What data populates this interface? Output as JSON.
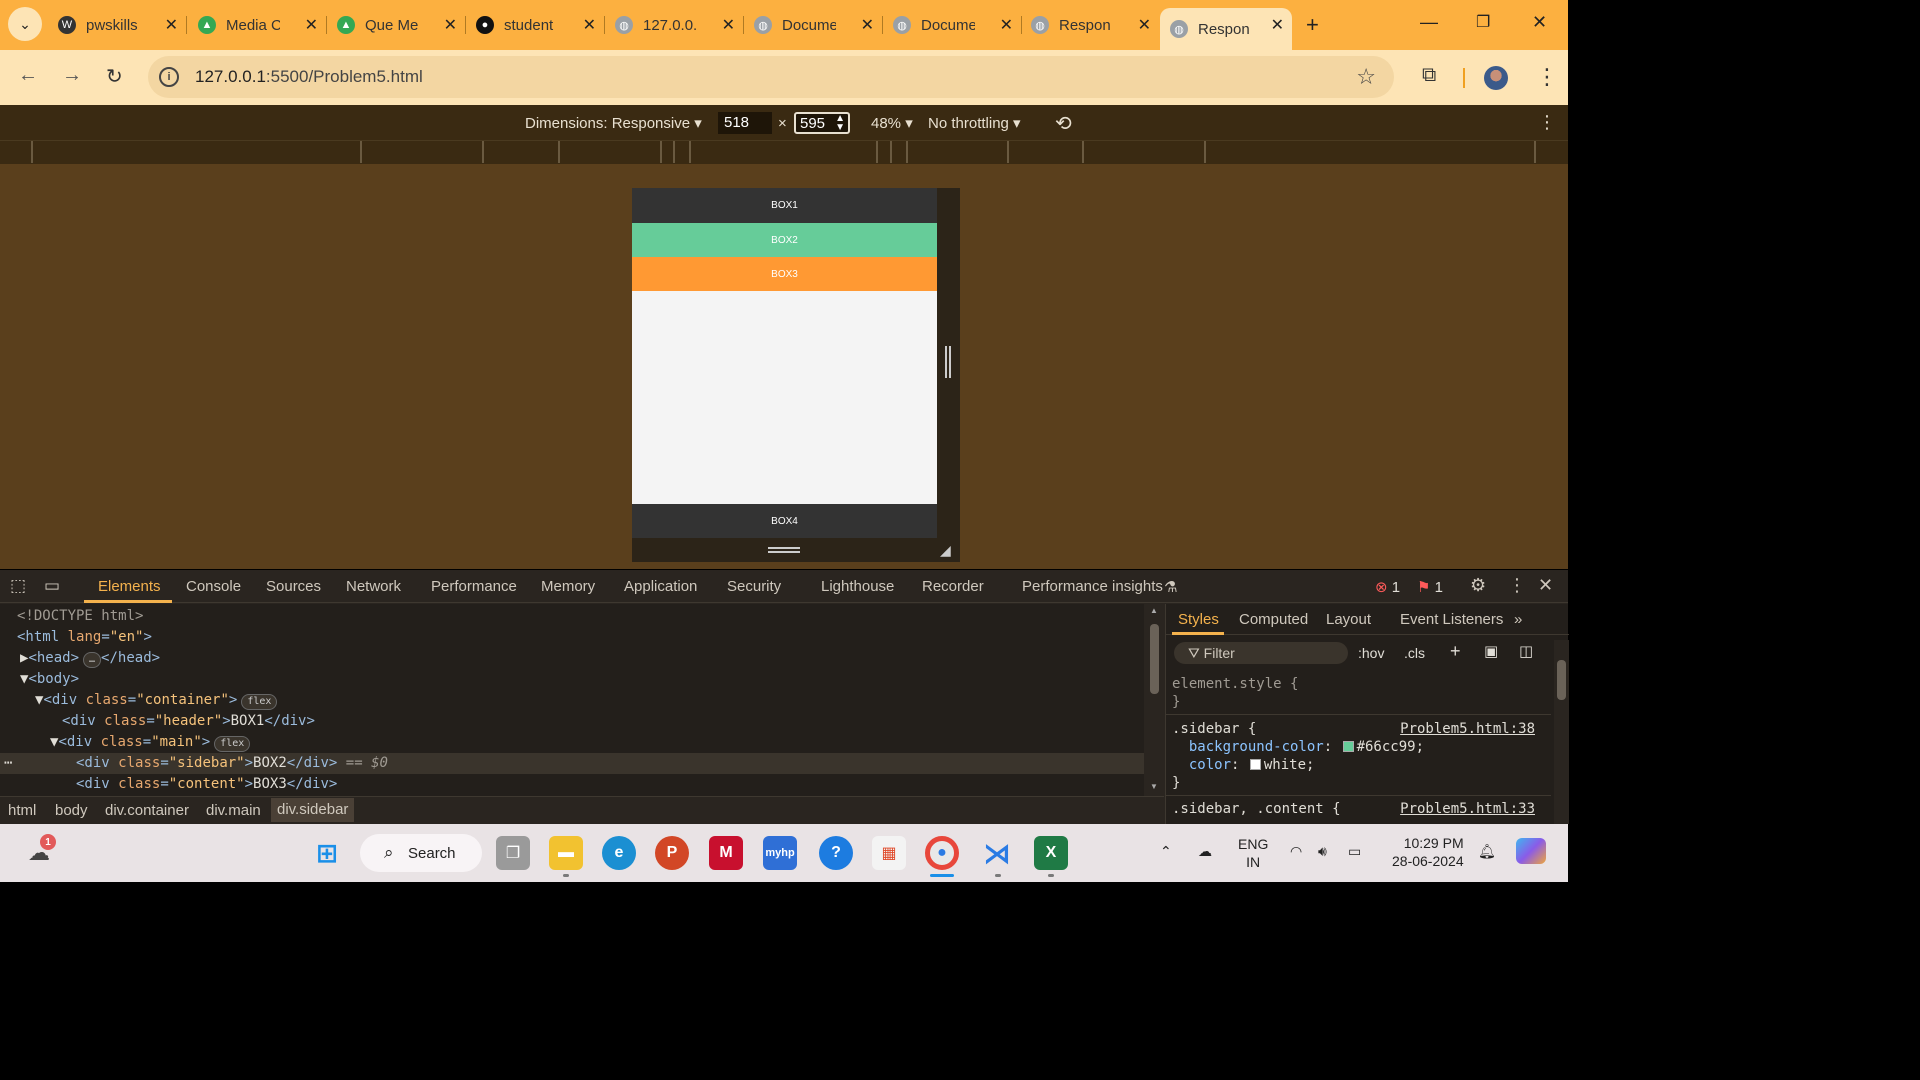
{
  "browser": {
    "tabs": [
      {
        "title": "pwskills",
        "icon": "wordpress-icon",
        "active": false
      },
      {
        "title": "Media C",
        "icon": "google-drive-icon",
        "active": false
      },
      {
        "title": "Que Me",
        "icon": "google-drive-icon",
        "active": false
      },
      {
        "title": "student",
        "icon": "github-icon",
        "active": false
      },
      {
        "title": "127.0.0.",
        "icon": "globe-icon",
        "active": false
      },
      {
        "title": "Docume",
        "icon": "globe-icon",
        "active": false
      },
      {
        "title": "Docume",
        "icon": "globe-icon",
        "active": false
      },
      {
        "title": "Respon",
        "icon": "globe-icon",
        "active": false
      },
      {
        "title": "Respon",
        "icon": "globe-icon",
        "active": true
      }
    ],
    "url_host": "127.0.0.1",
    "url_path": ":5500/Problem5.html"
  },
  "device_toolbar": {
    "dimensions_label": "Dimensions: Responsive",
    "width": "518",
    "height": "595",
    "times": "×",
    "zoom": "48%",
    "throttling": "No throttling"
  },
  "preview": {
    "boxes": [
      {
        "label": "BOX1",
        "color": "#333333"
      },
      {
        "label": "BOX2",
        "color": "#66cc99"
      },
      {
        "label": "BOX3",
        "color": "#ff9933"
      },
      {
        "label": "BOX4",
        "color": "#333333"
      }
    ]
  },
  "devtools": {
    "tabs": [
      "Elements",
      "Console",
      "Sources",
      "Network",
      "Performance",
      "Memory",
      "Application",
      "Security",
      "Lighthouse",
      "Recorder",
      "Performance insights"
    ],
    "error_count": "1",
    "issue_count": "1",
    "dom_lines": {
      "doctype": "<!DOCTYPE html>",
      "html_open": "<html",
      "html_attr": "lang",
      "html_val": "\"en\"",
      "head_open": "<head>",
      "head_close": "</head>",
      "body_open": "<body>",
      "container_open": "<div",
      "container_attr": "class",
      "container_val": "\"container\"",
      "flex_badge": "flex",
      "header_val": "\"header\"",
      "header_text": "BOX1",
      "main_val": "\"main\"",
      "sidebar_val": "\"sidebar\"",
      "sidebar_text": "BOX2",
      "sidebar_marker": "== $0",
      "content_val": "\"content\"",
      "content_text": "BOX3",
      "div_close": "</div>"
    },
    "breadcrumbs": [
      "html",
      "body",
      "div.container",
      "div.main",
      "div.sidebar"
    ],
    "styles_tabs": [
      "Styles",
      "Computed",
      "Layout",
      "Event Listeners"
    ],
    "filter_placeholder": "Filter",
    "hov": ":hov",
    "cls": ".cls",
    "element_style": "element.style {",
    "close_brace": "}",
    "sidebar_rule": {
      "selector": ".sidebar {",
      "source": "Problem5.html:38",
      "bg_prop": "background-color",
      "bg_value": "#66cc99;",
      "bg_swatch": "#66cc99",
      "color_prop": "color",
      "color_value": "white;"
    },
    "combined_rule": {
      "selector": ".sidebar, .content {",
      "source": "Problem5.html:33"
    }
  },
  "taskbar": {
    "search_label": "Search",
    "weather_badge": "1",
    "lang_top": "ENG",
    "lang_bottom": "IN",
    "time": "10:29 PM",
    "date": "28-06-2024"
  }
}
